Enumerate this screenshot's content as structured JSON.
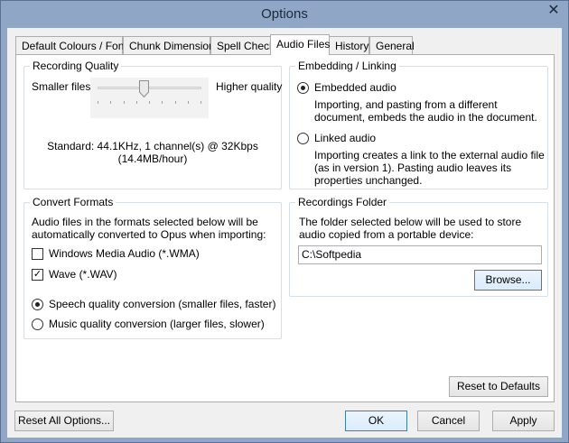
{
  "window": {
    "title": "Options",
    "close_glyph": "✕"
  },
  "tabs": [
    {
      "label": "Default Colours / Font"
    },
    {
      "label": "Chunk Dimensions"
    },
    {
      "label": "Spell Check"
    },
    {
      "label": "Audio Files",
      "active": true
    },
    {
      "label": "History"
    },
    {
      "label": "General"
    }
  ],
  "recording_quality": {
    "title": "Recording Quality",
    "left_label": "Smaller files",
    "right_label": "Higher quality",
    "slider_fraction": 0.44,
    "line1": "Standard: 44.1KHz, 1 channel(s) @ 32Kbps",
    "line2": "(14.4MB/hour)"
  },
  "embedding": {
    "title": "Embedding / Linking",
    "embedded_label": "Embedded audio",
    "embedded_desc": "Importing, and pasting from a different document, embeds the audio in the document.",
    "linked_label": "Linked audio",
    "linked_desc": "Importing creates a link to the external audio file (as in version 1). Pasting audio leaves its properties unchanged.",
    "selected": "embedded"
  },
  "convert": {
    "title": "Convert Formats",
    "desc": "Audio files in the formats selected below will be automatically converted to Opus when importing:",
    "wma_label": "Windows Media Audio (*.WMA)",
    "wma_checked": false,
    "wav_label": "Wave (*.WAV)",
    "wav_checked": true,
    "check_glyph": "✓",
    "speech_label": "Speech quality conversion (smaller files, faster)",
    "music_label": "Music quality conversion (larger files, slower)",
    "selected": "speech"
  },
  "folder": {
    "title": "Recordings Folder",
    "desc": "The folder selected below will be used to store audio copied from a portable device:",
    "path": "C:\\Softpedia",
    "browse_label": "Browse..."
  },
  "buttons": {
    "reset_defaults": "Reset to Defaults",
    "reset_all": "Reset All Options...",
    "ok": "OK",
    "cancel": "Cancel",
    "apply": "Apply"
  }
}
